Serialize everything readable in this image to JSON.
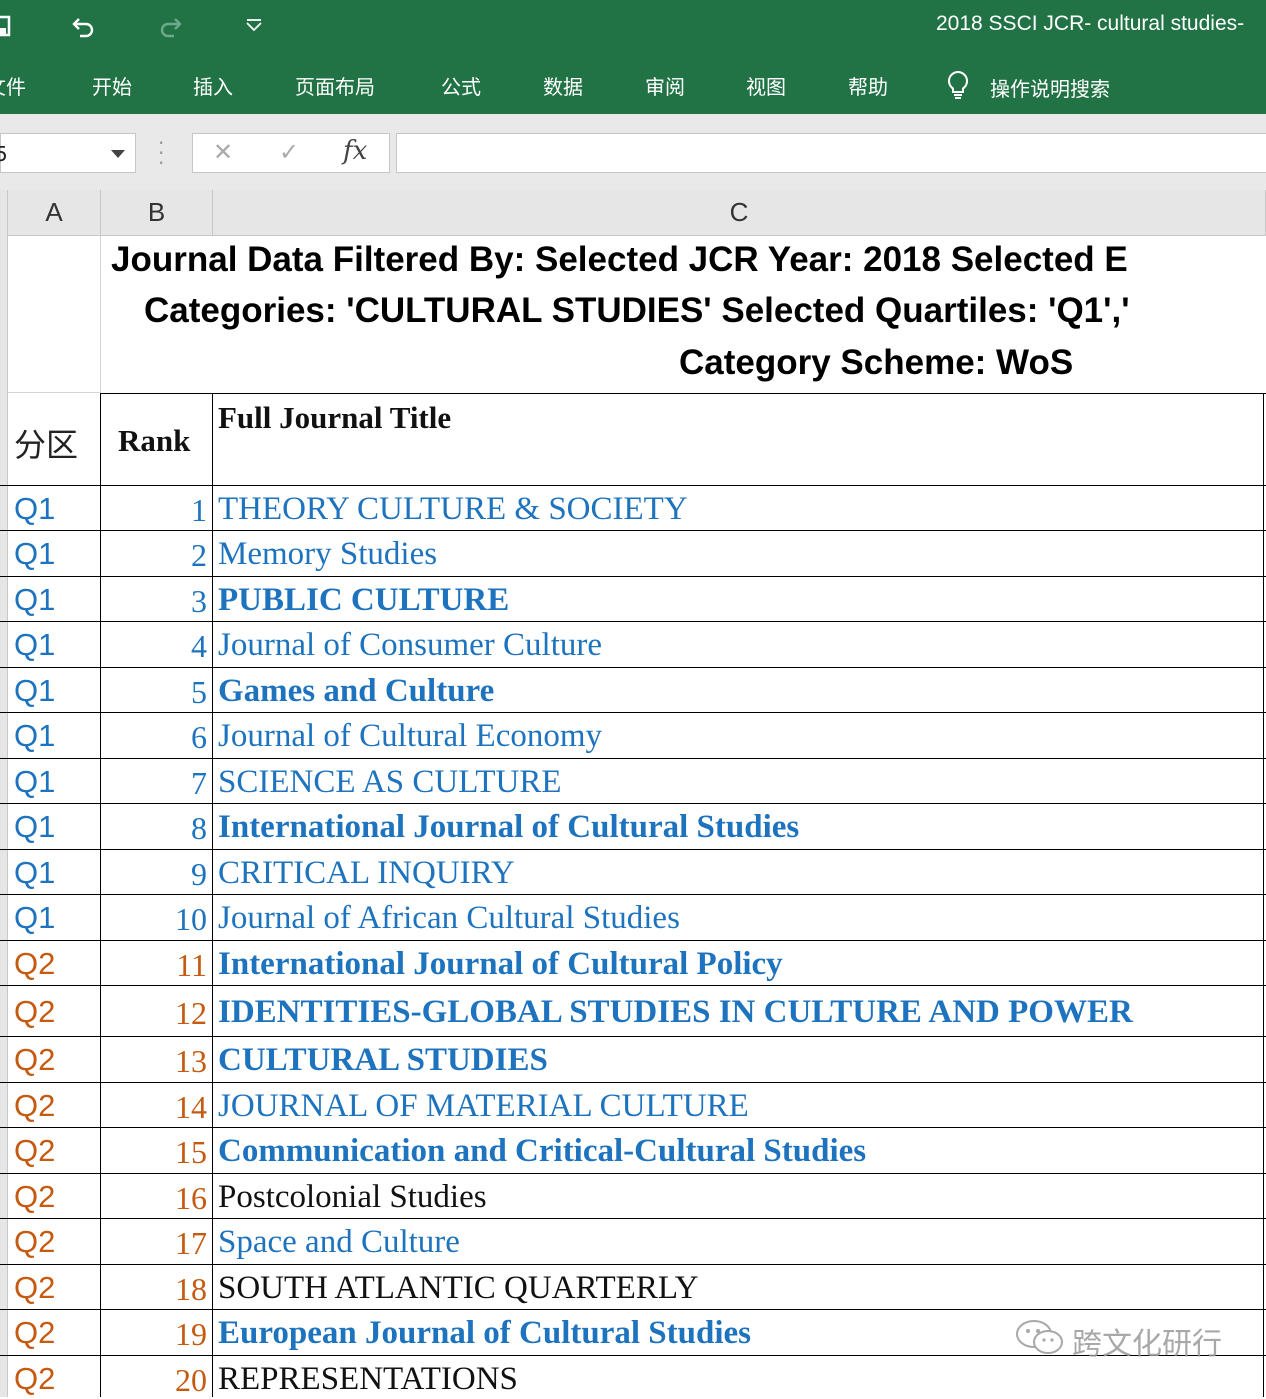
{
  "window": {
    "title": "2018 SSCI JCR- cultural studies-"
  },
  "ribbon": {
    "tabs": [
      "文件",
      "开始",
      "插入",
      "页面布局",
      "公式",
      "数据",
      "审阅",
      "视图",
      "帮助"
    ],
    "tell_me": "操作说明搜索"
  },
  "formula_bar": {
    "name_box": "5",
    "fx_label": "fx",
    "content": ""
  },
  "columns": [
    "A",
    "B",
    "C"
  ],
  "header": {
    "line1": "Journal Data Filtered By:  Selected JCR Year: 2018 Selected E",
    "line2": "Categories: 'CULTURAL STUDIES' Selected Quartiles: 'Q1','",
    "line3": "Category Scheme: WoS"
  },
  "table": {
    "headers": {
      "quartile": "分区",
      "rank": "Rank",
      "title": "Full Journal Title"
    },
    "rows": [
      {
        "quartile": "Q1",
        "rank": "1",
        "title": "THEORY CULTURE & SOCIETY",
        "bold": false,
        "color": "#1e73be"
      },
      {
        "quartile": "Q1",
        "rank": "2",
        "title": "Memory Studies",
        "bold": false,
        "color": "#1e73be"
      },
      {
        "quartile": "Q1",
        "rank": "3",
        "title": "PUBLIC CULTURE",
        "bold": true,
        "color": "#1e73be"
      },
      {
        "quartile": "Q1",
        "rank": "4",
        "title": "Journal of Consumer Culture",
        "bold": false,
        "color": "#1e73be"
      },
      {
        "quartile": "Q1",
        "rank": "5",
        "title": "Games and Culture",
        "bold": true,
        "color": "#1e73be"
      },
      {
        "quartile": "Q1",
        "rank": "6",
        "title": "Journal of Cultural Economy",
        "bold": false,
        "color": "#1e73be"
      },
      {
        "quartile": "Q1",
        "rank": "7",
        "title": "SCIENCE AS CULTURE",
        "bold": false,
        "color": "#1e73be"
      },
      {
        "quartile": "Q1",
        "rank": "8",
        "title": "International Journal of Cultural Studies",
        "bold": true,
        "color": "#1e73be"
      },
      {
        "quartile": "Q1",
        "rank": "9",
        "title": "CRITICAL INQUIRY",
        "bold": false,
        "color": "#1e73be"
      },
      {
        "quartile": "Q1",
        "rank": "10",
        "title": "Journal of African Cultural Studies",
        "bold": false,
        "color": "#1e73be"
      },
      {
        "quartile": "Q2",
        "rank": "11",
        "title": "International Journal of Cultural Policy",
        "bold": true,
        "color": "#1e73be"
      },
      {
        "quartile": "Q2",
        "rank": "12",
        "title": "IDENTITIES-GLOBAL STUDIES IN CULTURE AND POWER",
        "bold": true,
        "color": "#1e73be"
      },
      {
        "quartile": "Q2",
        "rank": "13",
        "title": "CULTURAL STUDIES",
        "bold": true,
        "color": "#1e73be"
      },
      {
        "quartile": "Q2",
        "rank": "14",
        "title": "JOURNAL OF MATERIAL CULTURE",
        "bold": false,
        "color": "#1e73be"
      },
      {
        "quartile": "Q2",
        "rank": "15",
        "title": "Communication and Critical-Cultural Studies",
        "bold": true,
        "color": "#1e73be"
      },
      {
        "quartile": "Q2",
        "rank": "16",
        "title": "Postcolonial Studies",
        "bold": false,
        "color": "#111111"
      },
      {
        "quartile": "Q2",
        "rank": "17",
        "title": "Space and Culture",
        "bold": false,
        "color": "#1e73be"
      },
      {
        "quartile": "Q2",
        "rank": "18",
        "title": "SOUTH ATLANTIC QUARTERLY",
        "bold": false,
        "color": "#111111"
      },
      {
        "quartile": "Q2",
        "rank": "19",
        "title": "European Journal of Cultural Studies",
        "bold": true,
        "color": "#1e73be"
      },
      {
        "quartile": "Q2",
        "rank": "20",
        "title": "REPRESENTATIONS",
        "bold": false,
        "color": "#111111"
      }
    ]
  },
  "colors": {
    "excel_green": "#217346",
    "q1": "#1e73be",
    "q2": "#c55a11"
  },
  "watermark": "跨文化研行"
}
